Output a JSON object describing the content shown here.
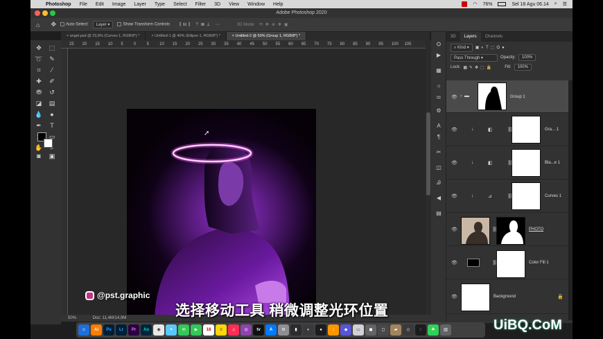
{
  "menubar": {
    "app": "Photoshop",
    "items": [
      "File",
      "Edit",
      "Image",
      "Layer",
      "Type",
      "Select",
      "Filter",
      "3D",
      "View",
      "Window",
      "Help"
    ],
    "battery": "76%",
    "datetime": "Sel 18 Agu 06.14"
  },
  "window": {
    "title": "Adobe Photoshop 2020"
  },
  "options": {
    "auto_select_label": "Auto-Select:",
    "auto_select_value": "Layer",
    "transform_label": "Show Transform Controls",
    "mode_label": "3D Mode:"
  },
  "tabs": [
    {
      "label": "angel.psd @ 23,8% (Curves 1, RGB/8*) *"
    },
    {
      "label": "Untitled-1 @ 40% (Ellipse 1, RGB/8*) *"
    },
    {
      "label": "Untitled-2 @ 50% (Group 1, RGB/8*) *"
    }
  ],
  "ruler": {
    "ticks": [
      "25",
      "20",
      "15",
      "10",
      "5",
      "0",
      "5",
      "10",
      "15",
      "20",
      "25",
      "30",
      "35",
      "40",
      "45",
      "50",
      "55",
      "60",
      "65",
      "70",
      "75",
      "80",
      "85",
      "90",
      "95",
      "100",
      "105"
    ]
  },
  "status": {
    "zoom": "50%",
    "doc": "Doc: 11,4M/14,9M"
  },
  "layers_panel": {
    "tabs": [
      "3D",
      "Layers",
      "Channels"
    ],
    "filter": "Kind",
    "blend_mode": "Pass Through",
    "opacity_label": "Opacity:",
    "opacity": "100%",
    "lock_label": "Lock:",
    "fill_label": "Fill:",
    "fill": "100%",
    "layers": [
      {
        "name": "Group 1"
      },
      {
        "name": "Gra... 1"
      },
      {
        "name": "Bla...e 1"
      },
      {
        "name": "Curves 1"
      },
      {
        "name": "PHOTO"
      },
      {
        "name": "Color Fill 1"
      },
      {
        "name": "Background"
      }
    ]
  },
  "dock": {
    "apps": [
      "Ai",
      "Ps",
      "Lr",
      "Pr",
      "Au"
    ]
  },
  "overlay": {
    "handle": "@pst.graphic",
    "caption": "选择移动工具 稍微调整光环位置",
    "watermark": "UiBQ.CoM"
  },
  "colors": {
    "accent": "#ff3cff",
    "panel_bg": "#323232",
    "selected_layer": "#4a4a4a"
  }
}
